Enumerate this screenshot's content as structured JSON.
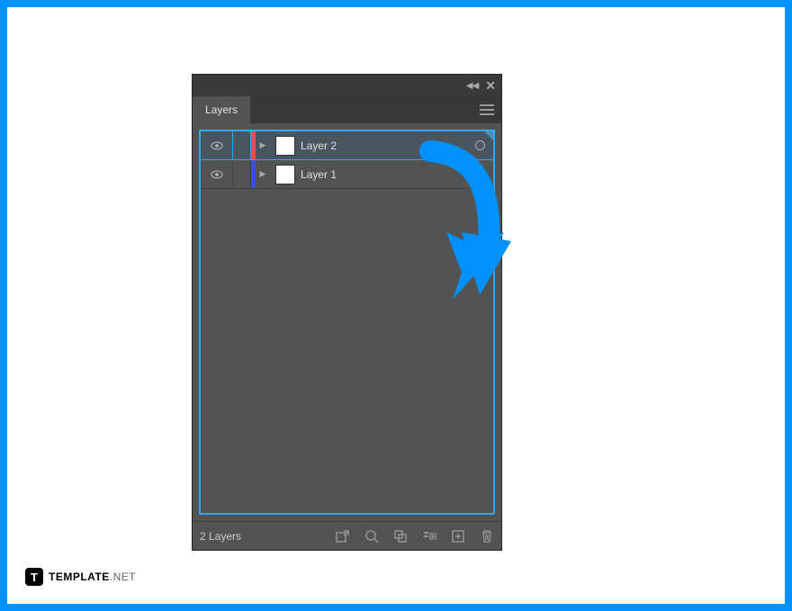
{
  "panel": {
    "tab_label": "Layers",
    "layer_count_text": "2 Layers"
  },
  "layers": [
    {
      "name": "Layer 2",
      "color": "#e74c5a",
      "selected": true,
      "show_target": true
    },
    {
      "name": "Layer 1",
      "color": "#3a4ed8",
      "selected": false,
      "show_target": false
    }
  ],
  "brand": {
    "icon_letter": "T",
    "name_bold": "TEMPLATE",
    "name_light": ".NET"
  },
  "colors": {
    "accent": "#0091ff",
    "highlight": "#32a7f3"
  }
}
